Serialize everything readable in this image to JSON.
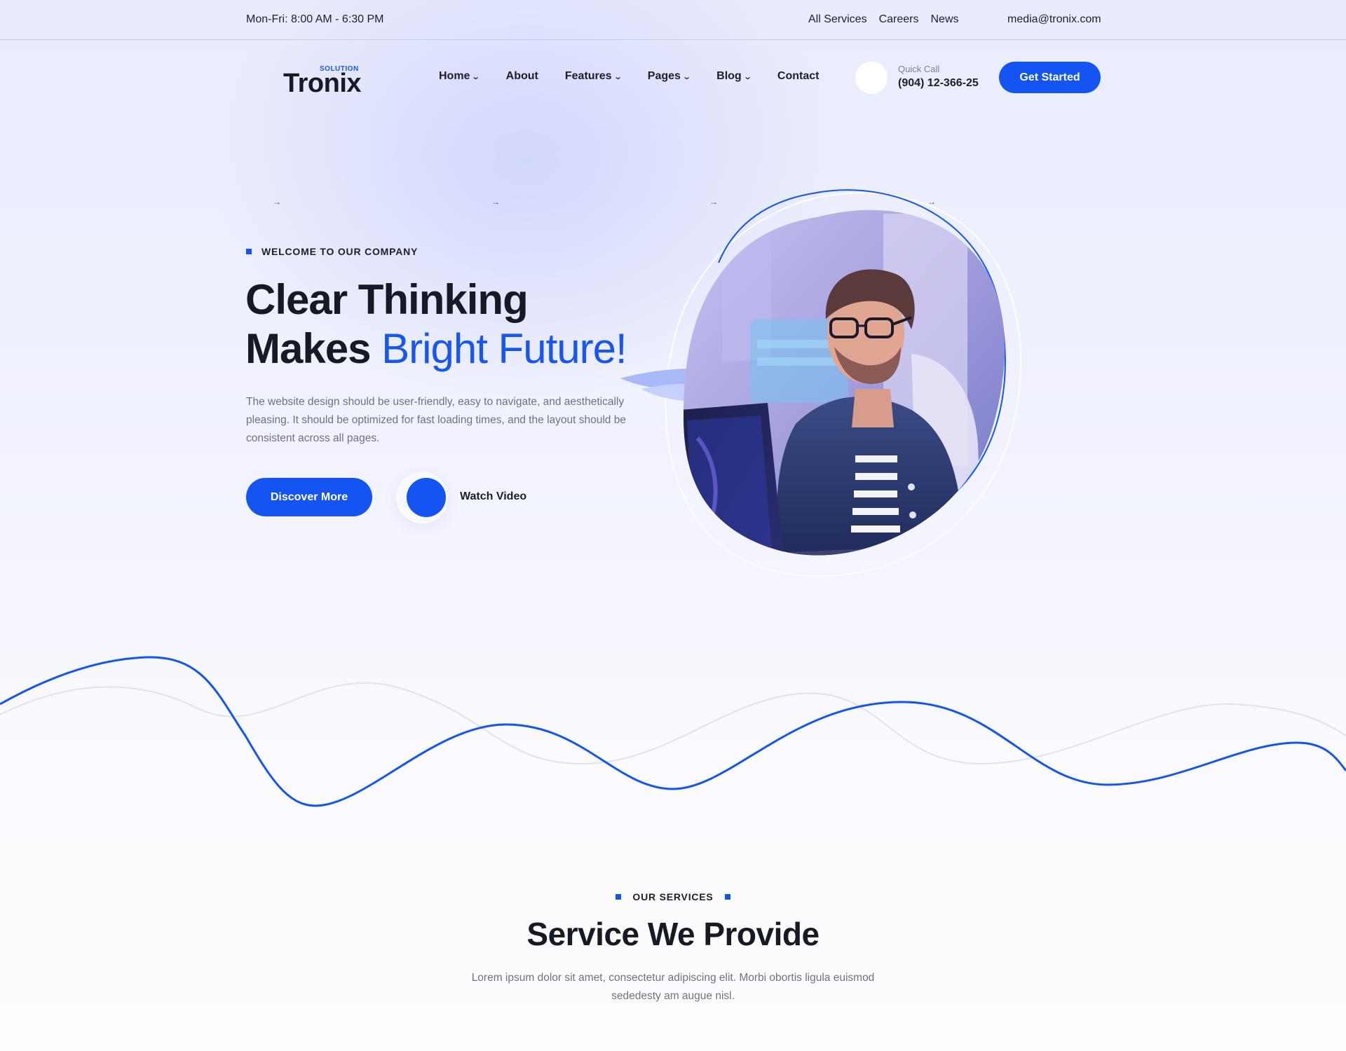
{
  "topbar": {
    "hours": "Mon-Fri: 8:00 AM - 6:30 PM",
    "links": [
      "All Services",
      "Careers",
      "News"
    ],
    "email": "media@tronix.com"
  },
  "header": {
    "logo_tag": "SOLUTION",
    "logo_name": "Tronix",
    "nav": [
      {
        "label": "Home",
        "has_dropdown": true
      },
      {
        "label": "About",
        "has_dropdown": false
      },
      {
        "label": "Features",
        "has_dropdown": true
      },
      {
        "label": "Pages",
        "has_dropdown": true
      },
      {
        "label": "Blog",
        "has_dropdown": true
      },
      {
        "label": "Contact",
        "has_dropdown": false
      }
    ],
    "quick_call_label": "Quick Call",
    "quick_call_number": "(904) 12-366-25",
    "cta_label": "Get Started"
  },
  "hero": {
    "eyebrow": "WELCOME TO OUR COMPANY",
    "headline_line1": "Clear Thinking",
    "headline_line2_plain": "Makes ",
    "headline_line2_accent": "Bright Future!",
    "description": "The website design should be user-friendly, easy to navigate, and aesthetically pleasing. It should be optimized for fast loading times, and the layout should be consistent across all pages.",
    "primary_button": "Discover More",
    "video_label": "Watch Video",
    "arrow_glyph": "→"
  },
  "services": {
    "eyebrow": "OUR SERVICES",
    "title": "Service We Provide",
    "description": "Lorem ipsum dolor sit amet, consectetur adipiscing elit. Morbi obortis ligula euismod sededesty am augue nisl."
  },
  "colors": {
    "accent": "#1454f2",
    "heading": "#161a24",
    "body_text": "#6d7282"
  },
  "icons": {
    "dropdown": "chevron-down-icon",
    "play": "play-icon",
    "phone": "phone-icon"
  }
}
